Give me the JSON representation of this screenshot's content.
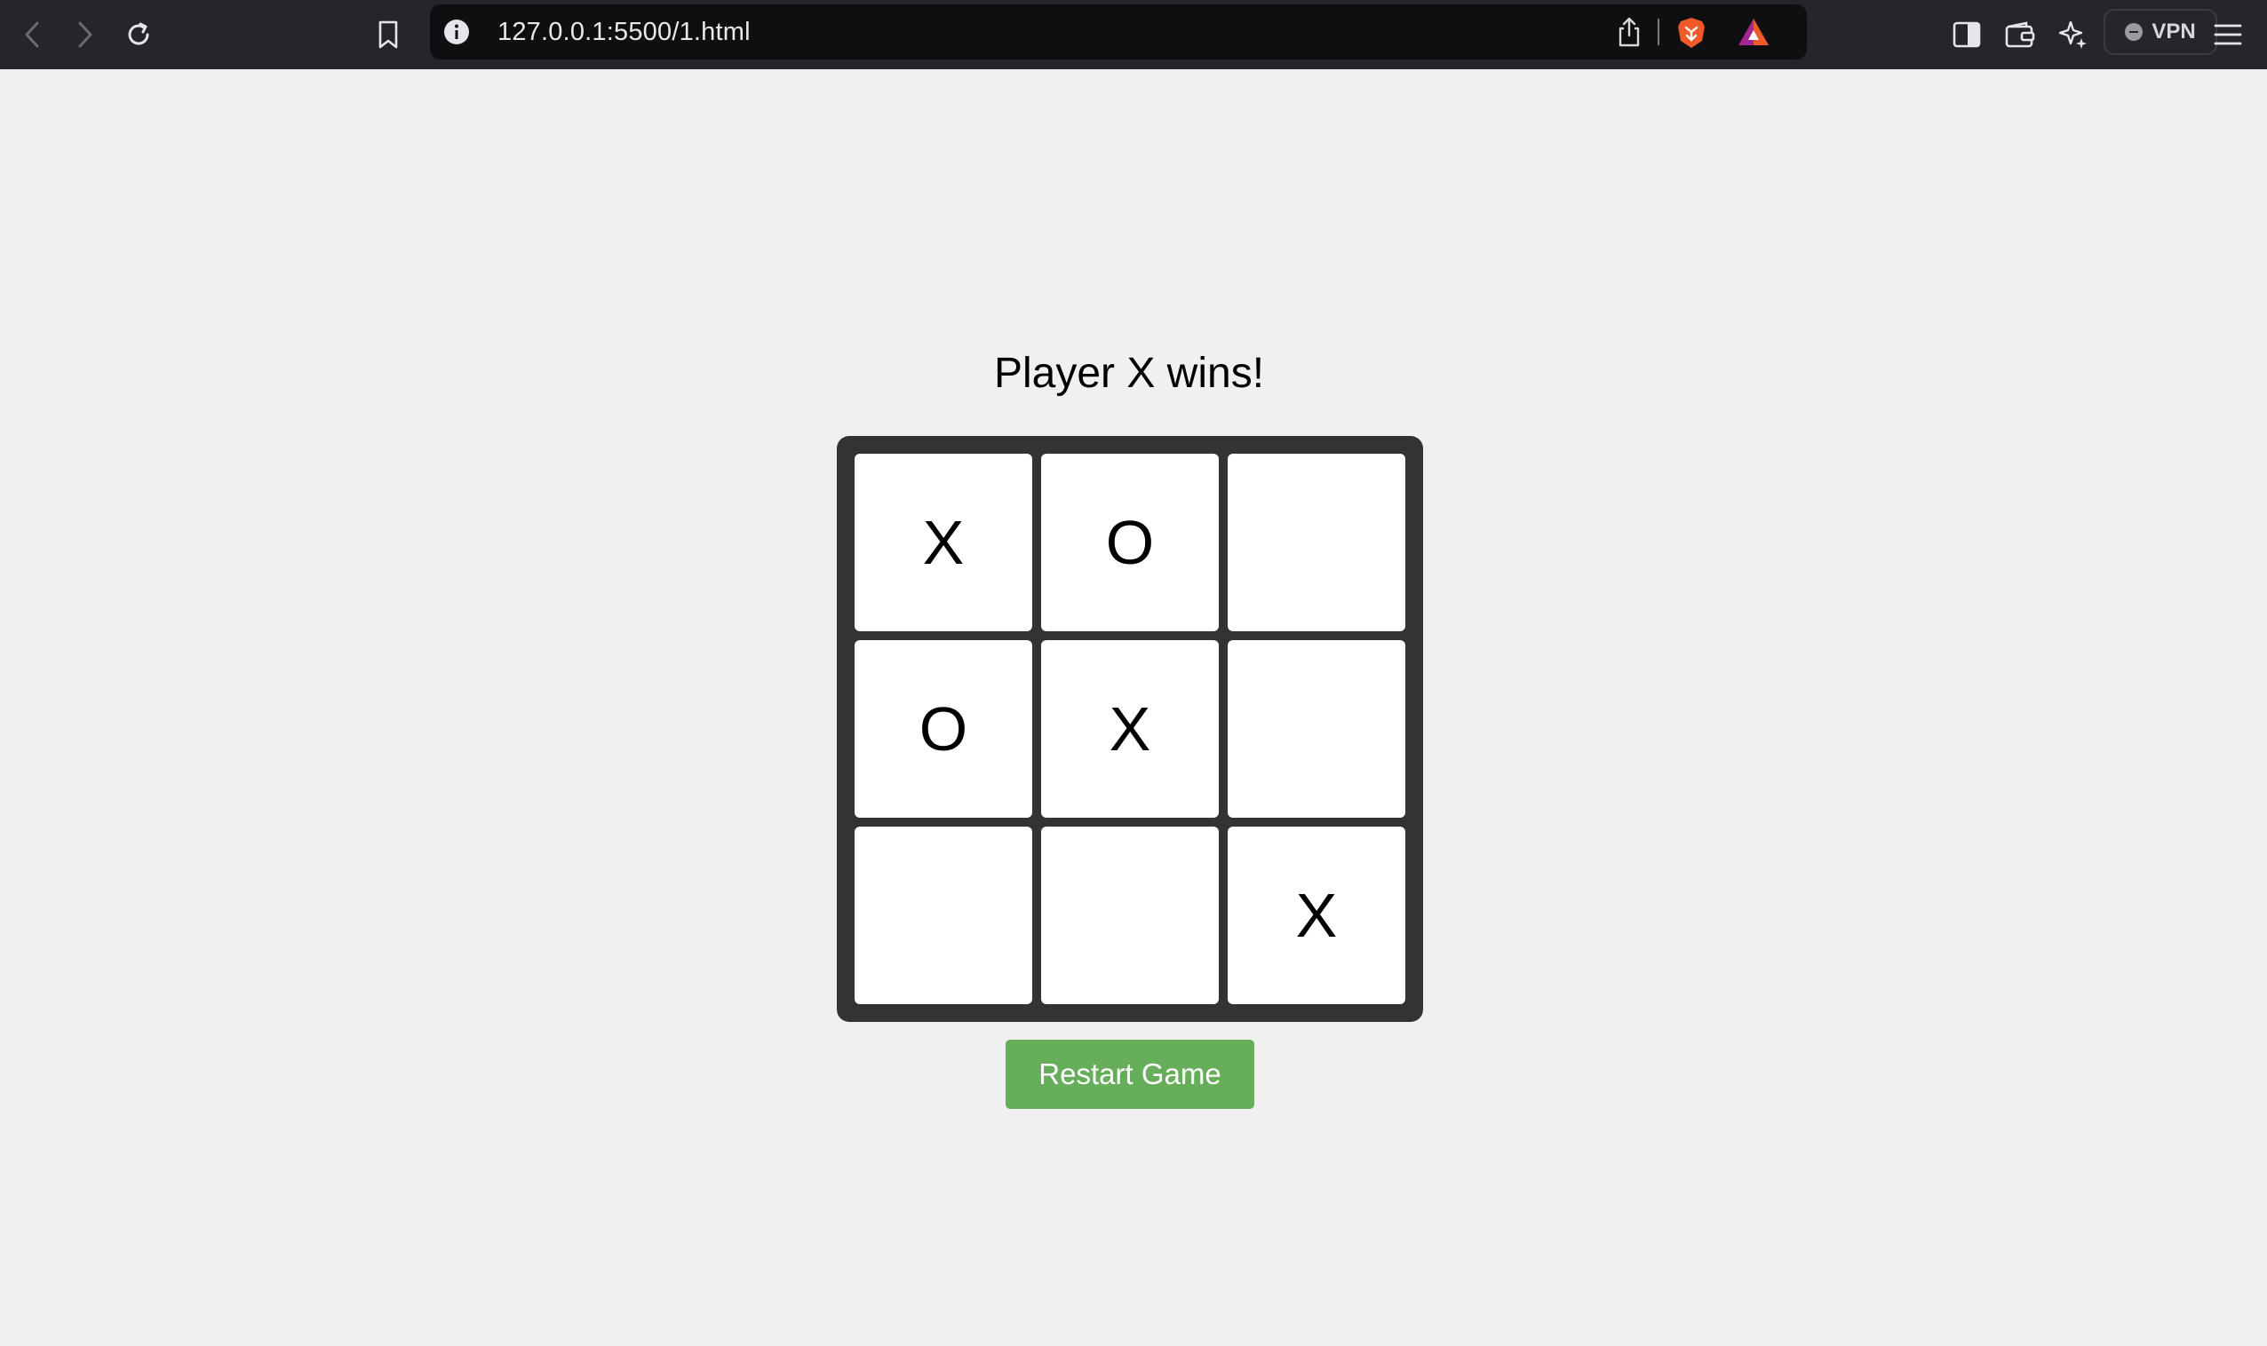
{
  "browser": {
    "url": "127.0.0.1:5500/1.html",
    "vpn_label": "VPN"
  },
  "game": {
    "status": "Player X wins!",
    "cells": [
      "X",
      "O",
      "",
      "O",
      "X",
      "",
      "",
      "",
      "X"
    ],
    "restart_label": "Restart Game"
  },
  "colors": {
    "toolbar_bg": "#25252b",
    "page_bg": "#f0f0f0",
    "board_bg": "#333333",
    "button_bg": "#67ae5b",
    "brave_orange": "#f05a28"
  }
}
